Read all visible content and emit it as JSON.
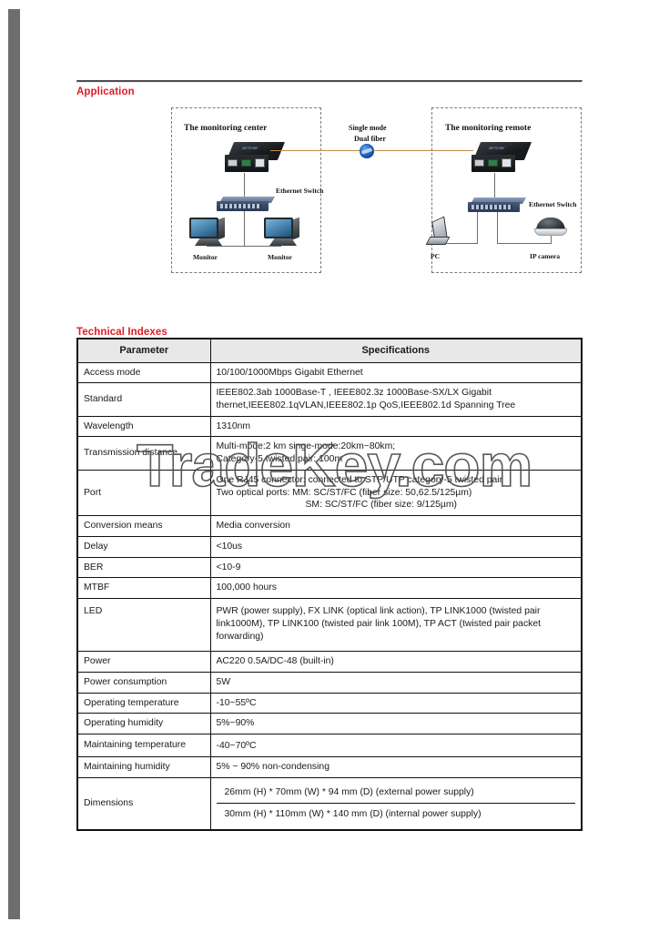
{
  "sections": {
    "application": {
      "title": "Application"
    },
    "technical": {
      "title": "Technical Indexes"
    }
  },
  "diagram": {
    "left_box_title": "The monitoring center",
    "right_box_title": "The monitoring remote",
    "fiber_label_line1": "Single mode",
    "fiber_label_line2": "Dual fiber",
    "left_switch_label": "Ethernet  Switch",
    "right_switch_label": "Ethernet  Switch",
    "monitor1_label": "Monitor",
    "monitor2_label": "Monitor",
    "pc_label": "PC",
    "ipcamera_label": "IP camera",
    "icons": {
      "globe": "globe-icon",
      "converter": "media-converter-icon",
      "switch": "ethernet-switch-icon",
      "monitor": "monitor-icon",
      "pc": "pc-tower-icon",
      "camera": "ip-camera-icon"
    }
  },
  "table": {
    "headers": {
      "parameter": "Parameter",
      "specifications": "Specifications"
    },
    "rows": [
      {
        "parameter": "Access mode",
        "value": "10/100/1000Mbps Gigabit Ethernet"
      },
      {
        "parameter": "Standard",
        "value": "IEEE802.3ab 1000Base-T , IEEE802.3z 1000Base-SX/LX Gigabit thernet,IEEE802.1qVLAN,IEEE802.1p QoS,IEEE802.1d Spanning Tree"
      },
      {
        "parameter": "Wavelength",
        "value": "1310nm"
      },
      {
        "parameter": "Transmission distance",
        "line1": "Multi-mode:2 km singe-mode:20km~80km;",
        "line2": "Category-5 twisted pair: 100m"
      },
      {
        "parameter": "Port",
        "line1": "One RJ45 connector: connected to STP/UTP category-5 twisted pair",
        "line2": "Two optical ports: MM: SC/ST/FC (fiber size: 50,62.5/125µm)",
        "line3": "SM: SC/ST/FC (fiber size: 9/125µm)"
      },
      {
        "parameter": "Conversion means",
        "value": "Media conversion"
      },
      {
        "parameter": "Delay",
        "value": "<10us"
      },
      {
        "parameter": "BER",
        "value": "<10-9"
      },
      {
        "parameter": "MTBF",
        "value": "100,000 hours"
      },
      {
        "parameter": "LED",
        "value": "PWR (power supply), FX LINK (optical link action), TP LINK1000 (twisted pair link1000M), TP LINK100 (twisted pair link 100M), TP ACT (twisted pair packet forwarding)"
      },
      {
        "parameter": "Power",
        "value": "AC220 0.5A/DC-48 (built-in)"
      },
      {
        "parameter": "Power consumption",
        "value": "5W"
      },
      {
        "parameter": "Operating temperature",
        "value": "-10~55ºC"
      },
      {
        "parameter": "Operating humidity",
        "value": "5%~90%"
      },
      {
        "parameter": "Maintaining temperature",
        "value": "-40~70ºC"
      },
      {
        "parameter": "Maintaining humidity",
        "value": "5% ~ 90% non-condensing"
      },
      {
        "parameter": "Dimensions",
        "line1": "26mm (H) * 70mm (W) * 94 mm (D) (external power supply)",
        "line2": "30mm (H) * 110mm (W) * 140 mm (D) (internal power supply)"
      }
    ]
  },
  "watermark": {
    "text": "TradeKey.com"
  },
  "colors": {
    "heading_red": "#e01b24",
    "table_header_bg": "#e8e8e8",
    "border": "#111111",
    "fiber": "#c08a4a",
    "scan_bar": "#6e6e6e"
  }
}
